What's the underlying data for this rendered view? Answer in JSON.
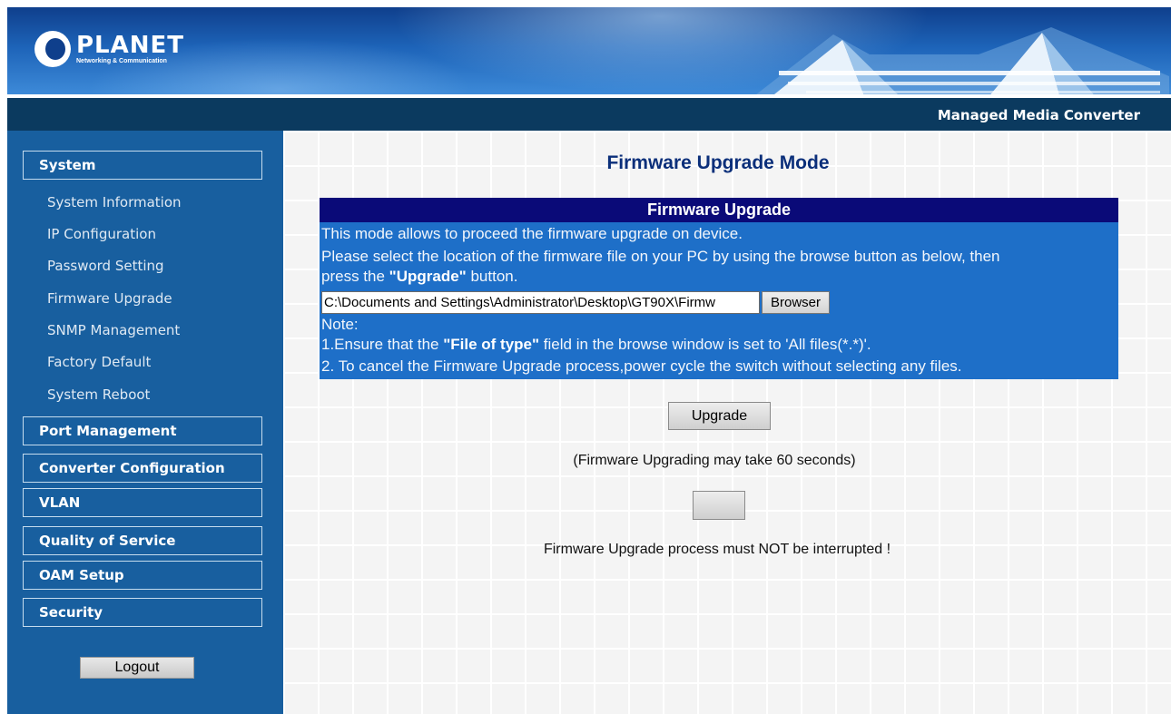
{
  "header": {
    "brand": "PLANET",
    "tagline": "Networking & Communication",
    "product_title": "Managed Media Converter"
  },
  "sidebar": {
    "sections": [
      {
        "label": "System"
      },
      {
        "label": "Port Management"
      },
      {
        "label": "Converter Configuration"
      },
      {
        "label": "VLAN"
      },
      {
        "label": "Quality of Service"
      },
      {
        "label": "OAM Setup"
      },
      {
        "label": "Security"
      }
    ],
    "system_items": [
      {
        "label": "System Information"
      },
      {
        "label": "IP Configuration"
      },
      {
        "label": "Password Setting"
      },
      {
        "label": "Firmware Upgrade"
      },
      {
        "label": "SNMP Management"
      },
      {
        "label": "Factory Default"
      },
      {
        "label": "System Reboot"
      }
    ],
    "logout_label": "Logout"
  },
  "main": {
    "page_title": "Firmware Upgrade Mode",
    "panel": {
      "title": "Firmware Upgrade",
      "line1": "This mode allows to proceed the firmware upgrade on device.",
      "line2": "Please select the location of the firmware file on your PC by using the browse button as below, then",
      "line3_prefix": "press the ",
      "line3_bold": "\"Upgrade\"",
      "line3_suffix": " button.",
      "file_value": "C:\\Documents and Settings\\Administrator\\Desktop\\GT90X\\Firmw",
      "browse_label": "Browser",
      "note_label": "Note:",
      "note1_prefix": "1.Ensure that the ",
      "note1_bold": "\"File of type\"",
      "note1_suffix": " field in the browse window is set to 'All files(*.*)'.",
      "note2": "2. To cancel the Firmware Upgrade process,power cycle the switch without selecting any files."
    },
    "upgrade_label": "Upgrade",
    "wait_note": "(Firmware Upgrading may take 60 seconds)",
    "warn_note": "Firmware Upgrade process must NOT be interrupted !"
  }
}
